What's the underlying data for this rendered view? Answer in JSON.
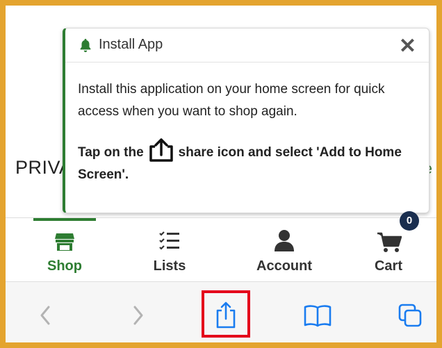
{
  "background": {
    "left_text": "PRIVA",
    "right_text": "re"
  },
  "popup": {
    "title": "Install App",
    "close_label": "✕",
    "body_text": "Install this application on your home screen for quick access when you want to shop again.",
    "tap_prefix": "Tap on the",
    "tap_suffix": "share icon and select 'Add to Home Screen'."
  },
  "tabbar": {
    "tabs": [
      {
        "label": "Shop",
        "icon": "store-icon",
        "active": true
      },
      {
        "label": "Lists",
        "icon": "list-icon",
        "active": false
      },
      {
        "label": "Account",
        "icon": "person-icon",
        "active": false
      },
      {
        "label": "Cart",
        "icon": "cart-icon",
        "active": false,
        "badge": "0"
      }
    ]
  },
  "browser": {
    "buttons": [
      "back-icon",
      "forward-icon",
      "share-icon",
      "bookmarks-icon",
      "tabs-icon"
    ]
  },
  "colors": {
    "accent": "#2e7d32",
    "ios_blue": "#1a7cf0",
    "frame": "#e4a42f",
    "highlight": "#e4001b",
    "badge": "#1a2e4f"
  }
}
